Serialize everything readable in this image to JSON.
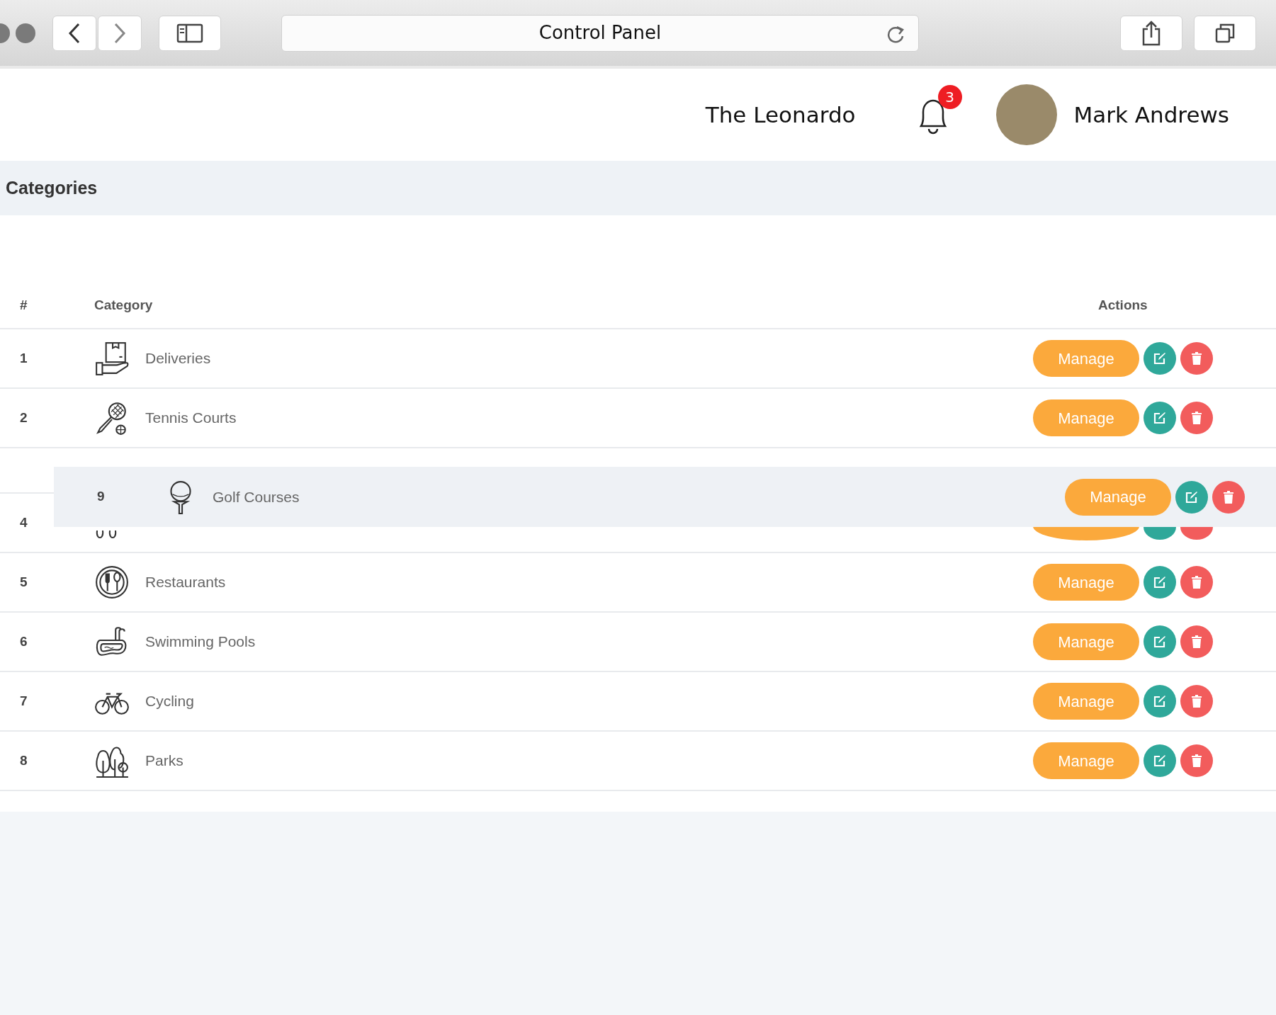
{
  "browser": {
    "title": "Control Panel"
  },
  "header": {
    "venue": "The Leonardo",
    "notifications": "3",
    "user": "Mark Andrews"
  },
  "section": {
    "title": "Categories"
  },
  "table": {
    "columns": [
      "#",
      "Category",
      "Actions"
    ],
    "rows": [
      {
        "kind": "item",
        "number": "1",
        "name": "Deliveries",
        "action": "Manage"
      },
      {
        "kind": "item",
        "number": "2",
        "name": "Tennis Courts",
        "action": "Manage"
      },
      {
        "kind": "placeholder"
      },
      {
        "kind": "item",
        "number": "4"
      },
      {
        "kind": "item",
        "number": "5",
        "name": "Restaurants",
        "action": "Manage"
      },
      {
        "kind": "item",
        "number": "6",
        "name": "Swimming Pools",
        "action": "Manage"
      },
      {
        "kind": "item",
        "number": "7",
        "name": "Cycling",
        "action": "Manage"
      },
      {
        "kind": "item",
        "number": "8",
        "name": "Parks",
        "action": "Manage"
      }
    ],
    "dragged_row": {
      "number": "9",
      "name": "Golf Courses",
      "action": "Manage"
    }
  }
}
